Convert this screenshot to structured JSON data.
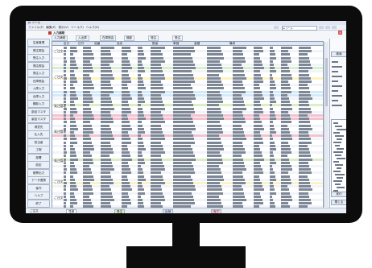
{
  "window": {
    "title": "Ja ツール"
  },
  "menu": [
    "ファイル(F)",
    "編集(E)",
    "表示(V)",
    "ツール(T)",
    "ヘルプ(H)"
  ],
  "search": {
    "value": "Ja ツール"
  },
  "app": {
    "title": "入力補助"
  },
  "tabs": [
    "入力補助",
    "入出庫",
    "在庫照会",
    "棚卸",
    "発注",
    "受注"
  ],
  "sidebar": [
    "生産管理",
    "受注照会",
    "受注入力",
    "発注照会",
    "発注入力",
    "在庫照会",
    "入庫入力",
    "出庫入力",
    "棚卸入力",
    "部品マスタ",
    "製品マスタ",
    "得意先",
    "仕入先",
    "担当者",
    "工程",
    "部署",
    "設定",
    "帳票出力",
    "データ連携",
    "保守",
    "ヘルプ",
    "終了"
  ],
  "grid_groups": [
    "ご注文",
    "ご注文",
    "発注管理",
    "発注管理",
    "発注管理",
    "ご注文",
    "ご注文"
  ],
  "grid_headers": [
    "区分",
    "日付",
    "品番",
    "品名",
    "数量",
    "単価",
    "金額",
    "備考"
  ],
  "right_panel": {
    "buttons": [
      "検索",
      "実行",
      "閉じる"
    ]
  },
  "statusbar": {
    "left": "ご注文",
    "legend": [
      {
        "label": "見積",
        "color": "#ffffff"
      },
      {
        "label": "受注",
        "color": "#d6f0c8"
      },
      {
        "label": "出荷",
        "color": "#cfe0f6"
      },
      {
        "label": "完了",
        "color": "#f6c7d2"
      }
    ]
  },
  "row_colors": {
    "normal": "#ffffff",
    "alt": "#f1f4fa",
    "highlight": "#f4c1cf",
    "select": "#d4eafa",
    "green": "#d8f0c4",
    "yellow": "#fbf3c2"
  }
}
